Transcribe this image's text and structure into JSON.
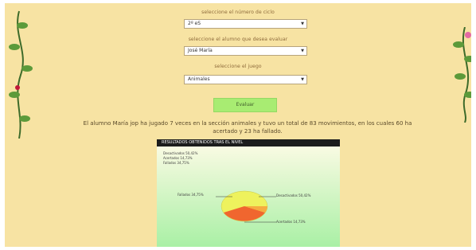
{
  "form": {
    "select_number_label": "seleccione el número de ciclo",
    "select_number_value": "2º eS",
    "select_student_label": "seleccione el alumno que desea evaluar",
    "select_student_value": "José María",
    "select_game_label": "seleccione el juego",
    "select_game_value": "Animales",
    "evaluate_button": "Evaluar"
  },
  "summary": {
    "text": "El alumno María jop ha jugado 7 veces en la sección animales y tuvo un total de 83 movimientos, en los cuales 60 ha acertado y 23 ha fallado."
  },
  "chart": {
    "header": "RESULTADOS OBTENIDOS TRAS EL NIVEL",
    "legend": [
      "Desactivados 50,42%",
      "Acertados 14,73%",
      "Fallados 34,75%"
    ],
    "labels": {
      "left": "Fallados 34,75%",
      "right": "Desactivados 50,42%",
      "bottom": "Acertados 14,73%"
    }
  },
  "chart_data": {
    "type": "pie",
    "title": "RESULTADOS OBTENIDOS TRAS EL NIVEL",
    "categories": [
      "Desactivados",
      "Acertados",
      "Fallados"
    ],
    "values": [
      50.42,
      14.73,
      34.75
    ],
    "colors": [
      "#eef25d",
      "#f05a2b",
      "#f6a43d"
    ],
    "legend_position": "top-left"
  }
}
